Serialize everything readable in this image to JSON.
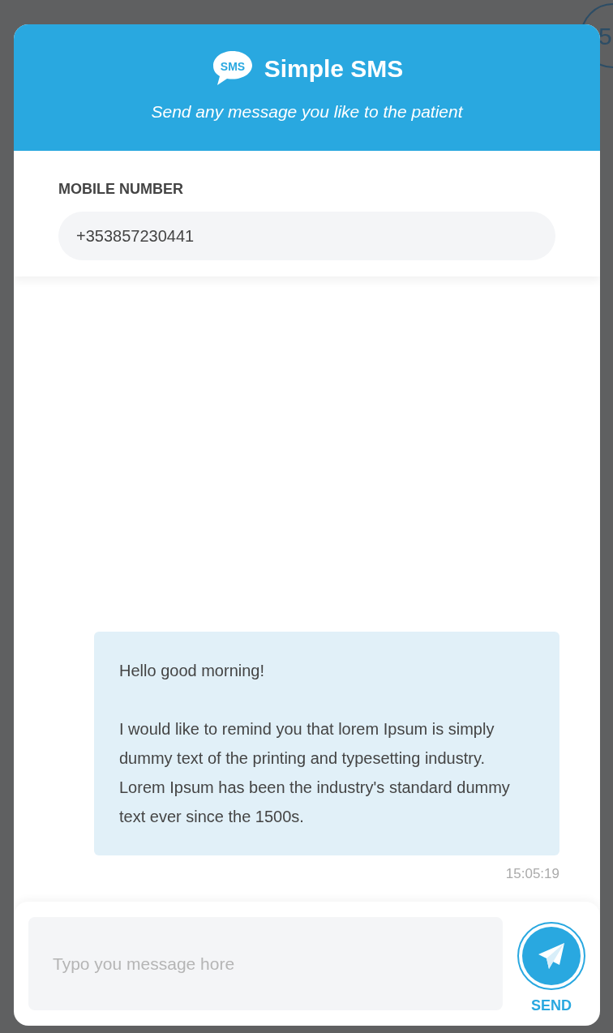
{
  "background_badge": {
    "text": "5"
  },
  "header": {
    "logo_text": "SMS",
    "title": "Simple SMS",
    "subtitle": "Send any message you like to the patient"
  },
  "mobile": {
    "label": "MOBILE NUMBER",
    "value": "+353857230441"
  },
  "messages": [
    {
      "paragraphs": [
        "Hello good morning!",
        "I would like to remind you that lorem Ipsum is simply dummy text of the printing and typesetting industry. Lorem Ipsum has been the industry's standard dummy text ever since the 1500s."
      ],
      "time": "15:05:19"
    }
  ],
  "composer": {
    "placeholder": "Typo you message hore",
    "send_label": "SEND"
  }
}
